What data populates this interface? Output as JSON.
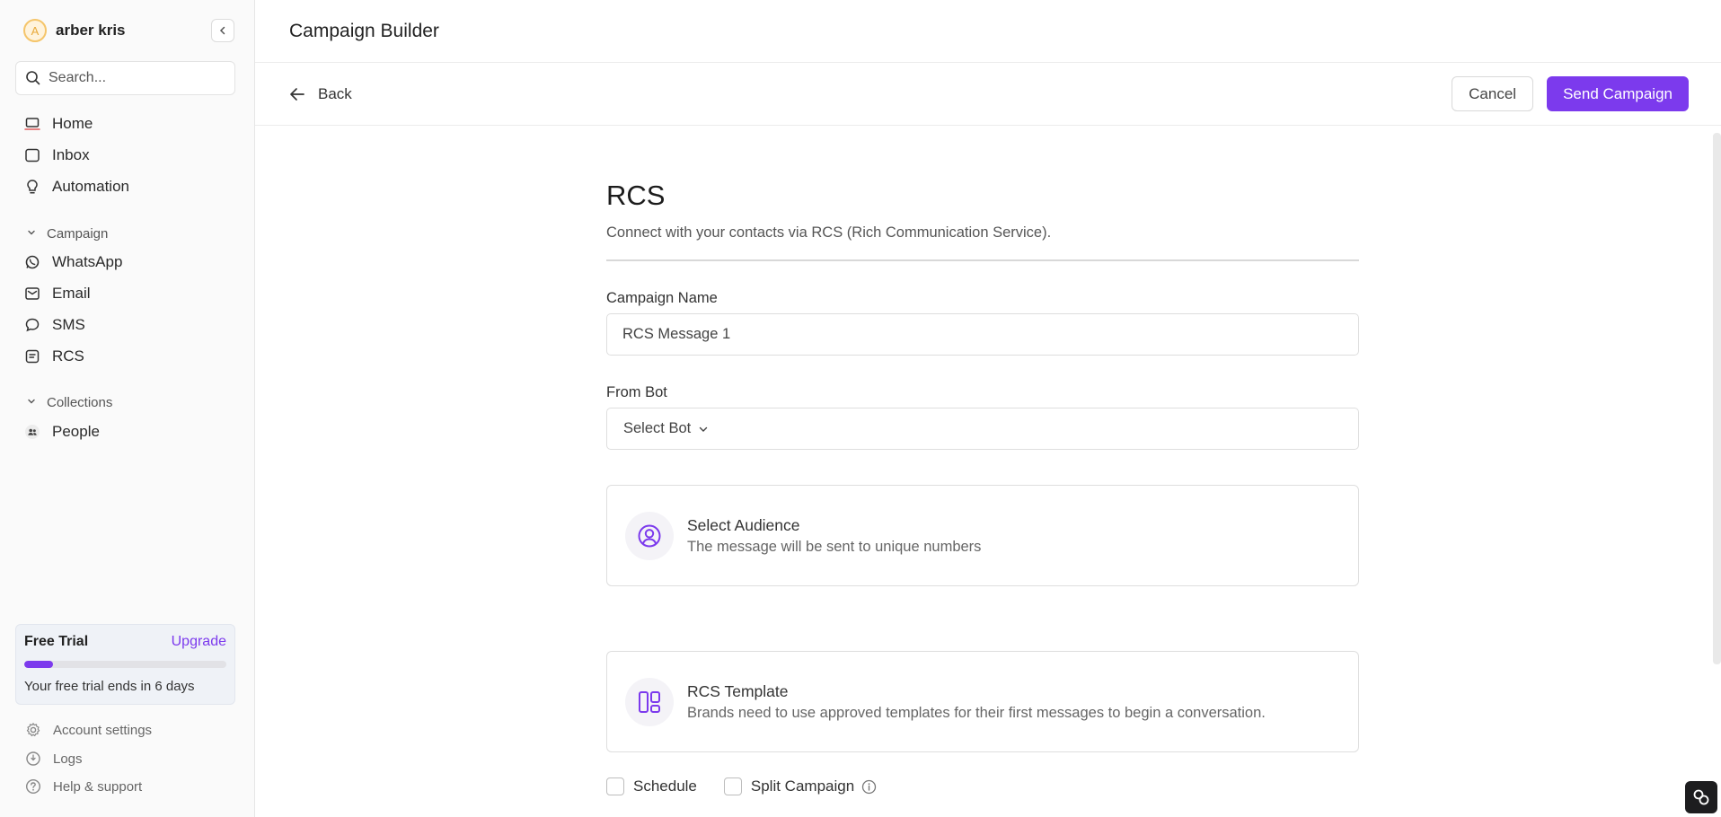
{
  "sidebar": {
    "user": {
      "name": "arber kris",
      "avatar_letter": "A"
    },
    "search": {
      "placeholder": "Search..."
    },
    "nav": [
      {
        "label": "Home",
        "icon": "laptop-icon"
      },
      {
        "label": "Inbox",
        "icon": "inbox-icon"
      },
      {
        "label": "Automation",
        "icon": "lightbulb-icon"
      }
    ],
    "campaign_section": {
      "label": "Campaign",
      "items": [
        {
          "label": "WhatsApp",
          "icon": "whatsapp-icon"
        },
        {
          "label": "Email",
          "icon": "mail-icon"
        },
        {
          "label": "SMS",
          "icon": "chat-bubble-icon"
        },
        {
          "label": "RCS",
          "icon": "message-square-icon"
        }
      ]
    },
    "collections_section": {
      "label": "Collections",
      "items": [
        {
          "label": "People",
          "icon": "people-icon"
        }
      ]
    },
    "trial": {
      "title": "Free Trial",
      "upgrade": "Upgrade",
      "text": "Your free trial ends in 6 days",
      "progress_percent": 14
    },
    "footer": [
      {
        "label": "Account settings",
        "icon": "gear-icon"
      },
      {
        "label": "Logs",
        "icon": "logs-icon"
      },
      {
        "label": "Help & support",
        "icon": "help-icon"
      }
    ]
  },
  "header": {
    "title": "Campaign Builder"
  },
  "actionbar": {
    "back": "Back",
    "cancel": "Cancel",
    "send": "Send Campaign"
  },
  "form": {
    "heading": "RCS",
    "subheading": "Connect with your contacts via RCS (Rich Communication Service).",
    "campaign_name_label": "Campaign Name",
    "campaign_name_value": "RCS Message 1",
    "from_bot_label": "From Bot",
    "from_bot_value": "Select Bot",
    "audience": {
      "title": "Select Audience",
      "desc": "The message will be sent to unique numbers"
    },
    "template": {
      "title": "RCS Template",
      "desc": "Brands need to use approved templates for their first messages to begin a conversation."
    },
    "schedule_label": "Schedule",
    "split_label": "Split Campaign"
  },
  "colors": {
    "accent": "#7c3aed",
    "trial_bg": "#eff2f7"
  }
}
